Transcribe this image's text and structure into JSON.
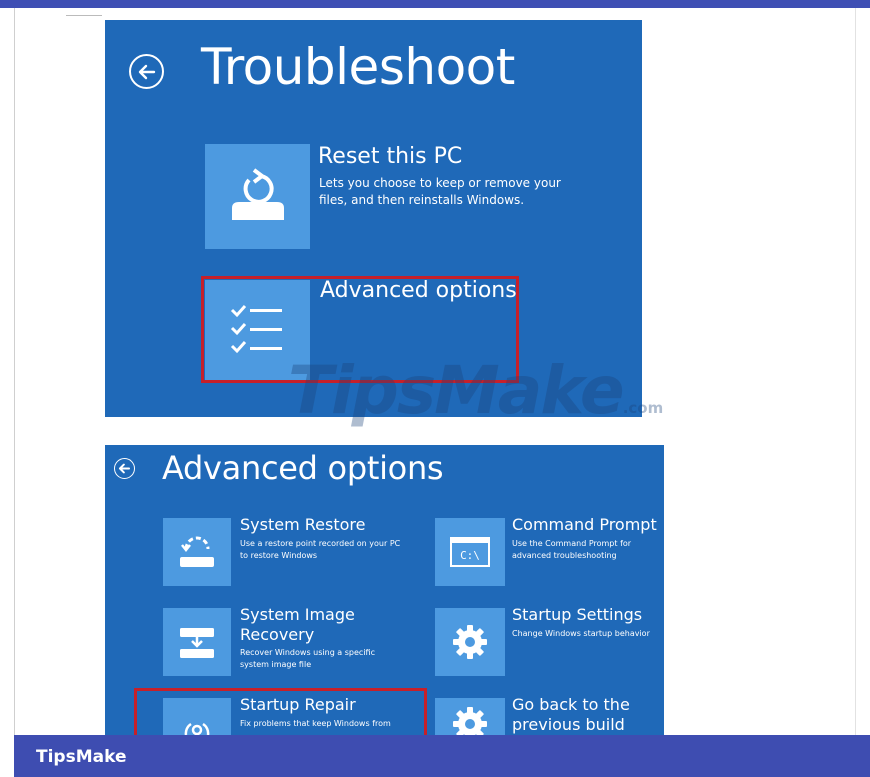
{
  "troubleshoot": {
    "title": "Troubleshoot",
    "reset": {
      "title": "Reset this PC",
      "desc": "Lets you choose to keep or remove your files, and then reinstalls Windows."
    },
    "advanced": {
      "title": "Advanced options"
    }
  },
  "watermark": {
    "text": "TipsMake",
    "suffix": ".com"
  },
  "advanced_options": {
    "title": "Advanced options",
    "items": [
      {
        "title": "System Restore",
        "desc": "Use a restore point recorded on your PC to restore Windows",
        "icon": "system-restore-icon"
      },
      {
        "title": "Command Prompt",
        "desc": "Use the Command Prompt for advanced troubleshooting",
        "icon": "command-prompt-icon",
        "icon_text": "C:\\"
      },
      {
        "title": "System Image Recovery",
        "desc": "Recover Windows using a specific system image file",
        "icon": "system-image-recovery-icon"
      },
      {
        "title": "Startup Settings",
        "desc": "Change Windows startup behavior",
        "icon": "gear-icon"
      },
      {
        "title": "Startup Repair",
        "desc": "Fix problems that keep Windows from",
        "icon": "startup-repair-icon"
      },
      {
        "title": "Go back to the previous build",
        "desc": "",
        "icon": "gear-icon"
      }
    ]
  },
  "footer": {
    "brand": "TipsMake"
  },
  "colors": {
    "panel": "#1f69b8",
    "tile": "#4d9ae0",
    "highlight": "#c6202a",
    "footer": "#3e4db1"
  }
}
